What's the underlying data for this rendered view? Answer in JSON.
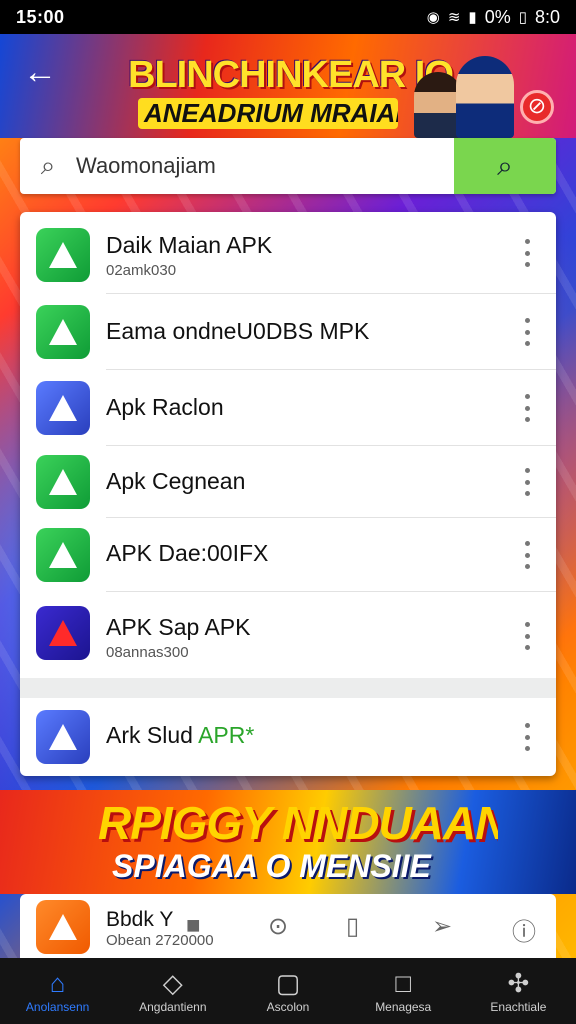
{
  "status_bar": {
    "time": "15:00",
    "battery_text": "0%",
    "clock_right": "8:0"
  },
  "header": {
    "title": "BLINCHINKEAR IO",
    "subtitle": "ANEADRIUM MRAIAKA"
  },
  "search": {
    "value": "Waomonajiam",
    "placeholder": ""
  },
  "apps": [
    {
      "name": "Daik Maian APK",
      "sub": "02amk030"
    },
    {
      "name": "Eama ondneU0DBS MPK",
      "sub": ""
    },
    {
      "name": "Apk Raclon",
      "sub": ""
    },
    {
      "name": "Apk Cegnean",
      "sub": ""
    },
    {
      "name": "APK Dae:00IFX",
      "sub": ""
    },
    {
      "name": "APK Sap APK",
      "sub": "08annas300"
    },
    {
      "name": "Ark Slud",
      "name_accent": "APR*",
      "sub": ""
    }
  ],
  "promo": {
    "title": "RPIGGY NNDUAAN",
    "subtitle": "SPIAGAA O MENSIIE"
  },
  "mini_item": {
    "name": "Bbdk Y",
    "sub": "Obean 2720000"
  },
  "bottom_nav": [
    {
      "label": "Anolansenn",
      "icon": "home-icon"
    },
    {
      "label": "Angdantienn",
      "icon": "tag-icon"
    },
    {
      "label": "Ascolon",
      "icon": "square-icon"
    },
    {
      "label": "Menagesa",
      "icon": "square-outline-icon"
    },
    {
      "label": "Enachtiale",
      "icon": "clover-icon"
    }
  ],
  "colors": {
    "search_button": "#7ad64e",
    "nav_active": "#2f7bff"
  }
}
